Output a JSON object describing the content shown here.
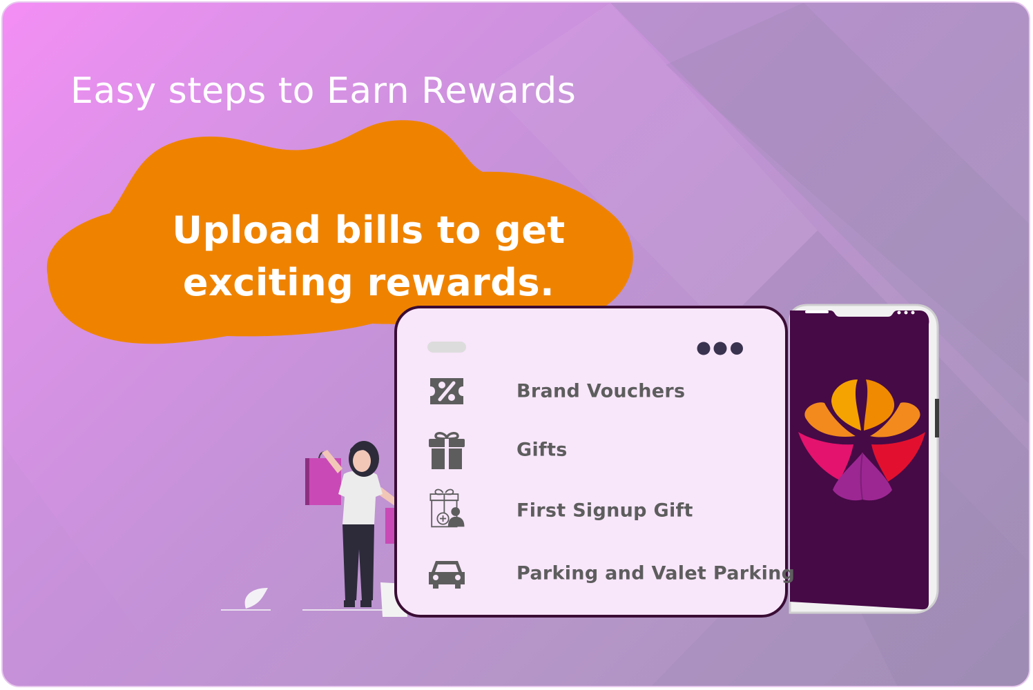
{
  "headline": "Easy steps to Earn Rewards",
  "tagline": "Upload bills to get exciting rewards.",
  "colors": {
    "accent_orange": "#ef8300",
    "card_border": "#3a0d35",
    "phone_screen": "#460a46",
    "label_gray": "#5d5d5d"
  },
  "menu": {
    "items": [
      {
        "label": "Brand Vouchers",
        "icon": "voucher-icon"
      },
      {
        "label": "Gifts",
        "icon": "gift-icon"
      },
      {
        "label": "First Signup Gift",
        "icon": "signup-gift-icon"
      },
      {
        "label": "Parking and Valet Parking",
        "icon": "car-icon"
      }
    ]
  }
}
